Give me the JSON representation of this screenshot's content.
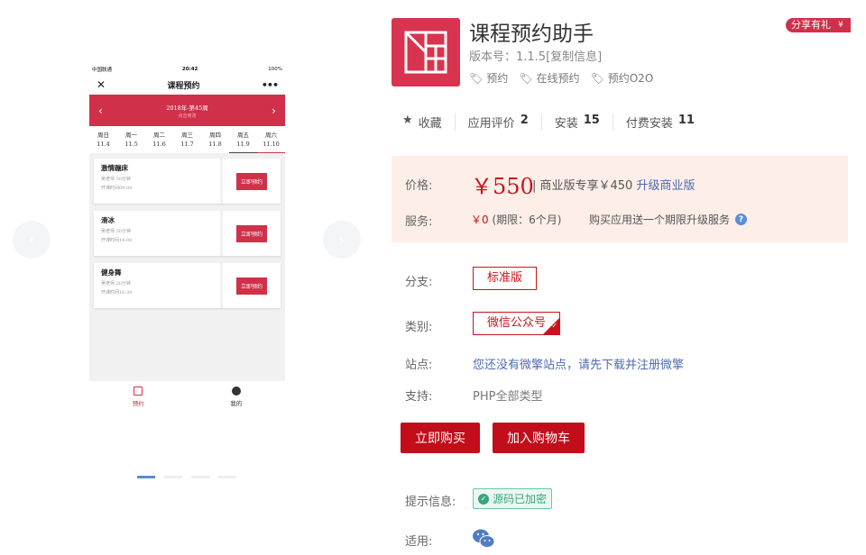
{
  "phone": {
    "status": {
      "carrier": "中国联通",
      "time": "20:42",
      "battery": "100%"
    },
    "nav": {
      "title": "课程预约",
      "close_icon": "close-icon",
      "more_icon": "more-icon"
    },
    "week": {
      "title": "2018年-第45周",
      "subtitle": "点击修改"
    },
    "days": [
      {
        "name": "周日",
        "date": "11.4"
      },
      {
        "name": "周一",
        "date": "11.5"
      },
      {
        "name": "周二",
        "date": "11.6"
      },
      {
        "name": "周三",
        "date": "11.7"
      },
      {
        "name": "周四",
        "date": "11.8"
      },
      {
        "name": "周五",
        "date": "11.9"
      },
      {
        "name": "周六",
        "date": "11.10"
      }
    ],
    "courses": [
      {
        "name": "激情蹦床",
        "teacher": "吴老师 50分钟",
        "time": "开课时间09:00",
        "button": "立即预约"
      },
      {
        "name": "滑冰",
        "teacher": "吴老师 30分钟",
        "time": "开课时间14:00",
        "button": "立即预约"
      },
      {
        "name": "健身舞",
        "teacher": "吴老师 30分钟",
        "time": "开课时间16:30",
        "button": "立即预约"
      }
    ],
    "tabs": [
      {
        "label": "预约",
        "icon": "calendar-icon"
      },
      {
        "label": "我的",
        "icon": "user-icon"
      }
    ]
  },
  "app": {
    "title": "课程预约助手",
    "version": "版本号：1.1.5",
    "copy_info": "[复制信息]",
    "tags": [
      "预约",
      "在线预约",
      "预约O2O"
    ],
    "share": "分享有礼",
    "brand_color": "#d8344f"
  },
  "stats": {
    "favorite": "收藏",
    "rating_label": "应用评价",
    "rating_value": "2",
    "install_label": "安装",
    "install_value": "15",
    "paid_label": "付费安装",
    "paid_value": "11"
  },
  "pricing": {
    "price_label": "价格:",
    "price": "￥550",
    "business_text": "| 商业版专享￥450",
    "upgrade_link": "升级商业版",
    "service_label": "服务:",
    "service_price": "￥0",
    "service_period": "(期限：6个月)",
    "service_note": "购买应用送一个期限升级服务"
  },
  "options": {
    "branch_label": "分支:",
    "branch_value": "标准版",
    "category_label": "类别:",
    "category_value": "微信公众号",
    "site_label": "站点:",
    "site_value": "您还没有微擎站点，请先下载并注册微擎",
    "support_label": "支持:",
    "support_value": "PHP全部类型"
  },
  "actions": {
    "buy": "立即购买",
    "cart": "加入购物车"
  },
  "info": {
    "tip_label": "提示信息:",
    "tip_badge": "源码已加密",
    "apply_label": "适用:"
  }
}
